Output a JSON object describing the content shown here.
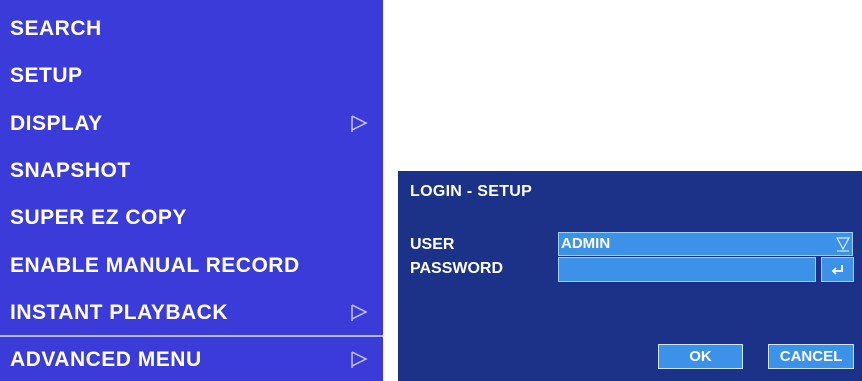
{
  "menu": {
    "items": [
      {
        "label": "SEARCH",
        "has_submenu": false
      },
      {
        "label": "SETUP",
        "has_submenu": false
      },
      {
        "label": "DISPLAY",
        "has_submenu": true
      },
      {
        "label": "SNAPSHOT",
        "has_submenu": false
      },
      {
        "label": "SUPER  EZ  COPY",
        "has_submenu": false
      },
      {
        "label": "ENABLE  MANUAL  RECORD",
        "has_submenu": false
      },
      {
        "label": "INSTANT  PLAYBACK",
        "has_submenu": true
      },
      {
        "label": "ADVANCED  MENU",
        "has_submenu": true
      }
    ],
    "submenu_icon": "submenu-arrow-icon",
    "colors": {
      "background": "#3a3bd9",
      "text": "#ffffff"
    }
  },
  "login_dialog": {
    "title": "LOGIN  -  SETUP",
    "user": {
      "label": "USER",
      "value": "ADMIN",
      "icon": "dropdown-icon"
    },
    "password": {
      "label": "PASSWORD",
      "value": "",
      "icon": "enter-key-icon"
    },
    "buttons": {
      "ok": "OK",
      "cancel": "CANCEL"
    },
    "colors": {
      "background": "#1b3288",
      "field": "#3b92e8",
      "text": "#ffffff"
    }
  }
}
